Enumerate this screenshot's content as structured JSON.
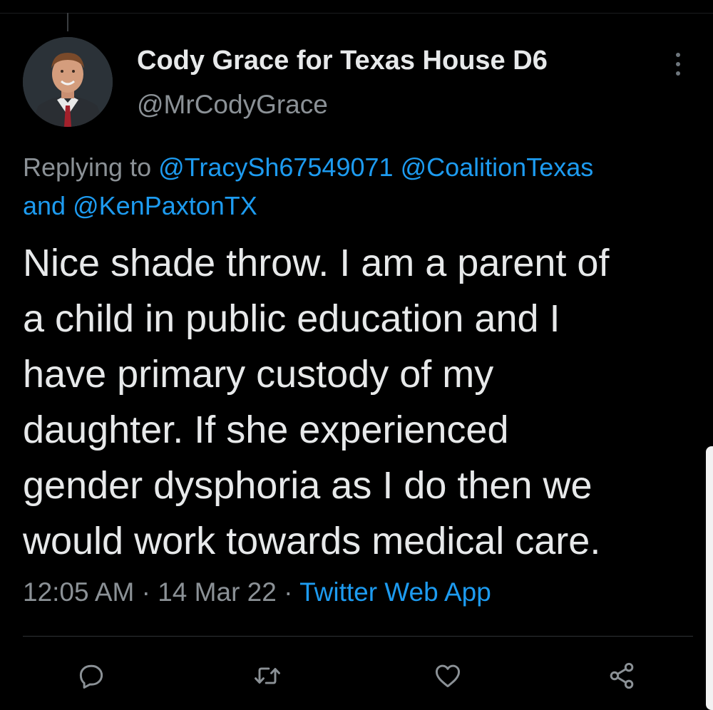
{
  "tweet": {
    "display_name": "Cody Grace for Texas House D6",
    "handle": "@MrCodyGrace",
    "replying_prefix": "Replying to",
    "mentions": [
      "@TracySh67549071",
      "@CoalitionTexas"
    ],
    "and_word": "and",
    "last_mention": "@KenPaxtonTX",
    "text": "Nice shade throw. I am a parent of\na child in public education and I\nhave primary custody of my\ndaughter. If she experienced\ngender dysphoria as I do then we\nwould work towards medical care.",
    "time": "12:05 AM",
    "separator": "·",
    "date": "14 Mar 22",
    "source": "Twitter Web App"
  },
  "actions": [
    {
      "name": "reply",
      "icon": "reply-icon"
    },
    {
      "name": "retweet",
      "icon": "retweet-icon"
    },
    {
      "name": "like",
      "icon": "heart-icon"
    },
    {
      "name": "share",
      "icon": "share-icon"
    }
  ],
  "colors": {
    "background": "#000000",
    "text": "#e7e9ea",
    "secondary": "#8b9196",
    "link": "#1d9bf0",
    "divider": "#2f3336"
  }
}
